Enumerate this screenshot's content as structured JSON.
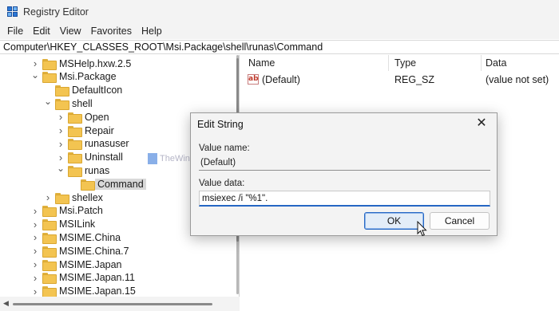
{
  "window": {
    "title": "Registry Editor"
  },
  "menu": [
    "File",
    "Edit",
    "View",
    "Favorites",
    "Help"
  ],
  "address": "Computer\\HKEY_CLASSES_ROOT\\Msi.Package\\shell\\runas\\Command",
  "tree": [
    {
      "label": "MSHelp.hxw.2.5",
      "level": 0,
      "chevron": "right"
    },
    {
      "label": "Msi.Package",
      "level": 0,
      "chevron": "down"
    },
    {
      "label": "DefaultIcon",
      "level": 1,
      "chevron": "none"
    },
    {
      "label": "shell",
      "level": 1,
      "chevron": "down"
    },
    {
      "label": "Open",
      "level": 2,
      "chevron": "right"
    },
    {
      "label": "Repair",
      "level": 2,
      "chevron": "right"
    },
    {
      "label": "runasuser",
      "level": 2,
      "chevron": "right"
    },
    {
      "label": "Uninstall",
      "level": 2,
      "chevron": "right"
    },
    {
      "label": "runas",
      "level": 2,
      "chevron": "down"
    },
    {
      "label": "Command",
      "level": 3,
      "chevron": "none",
      "selected": true
    },
    {
      "label": "shellex",
      "level": 1,
      "chevron": "right"
    },
    {
      "label": "Msi.Patch",
      "level": 0,
      "chevron": "right"
    },
    {
      "label": "MSILink",
      "level": 0,
      "chevron": "right"
    },
    {
      "label": "MSIME.China",
      "level": 0,
      "chevron": "right"
    },
    {
      "label": "MSIME.China.7",
      "level": 0,
      "chevron": "right"
    },
    {
      "label": "MSIME.Japan",
      "level": 0,
      "chevron": "right"
    },
    {
      "label": "MSIME.Japan.11",
      "level": 0,
      "chevron": "right"
    },
    {
      "label": "MSIME.Japan.15",
      "level": 0,
      "chevron": "right"
    }
  ],
  "values_pane": {
    "headers": {
      "name": "Name",
      "type": "Type",
      "data": "Data"
    },
    "rows": [
      {
        "icon": "string-value-icon",
        "name": "(Default)",
        "type": "REG_SZ",
        "data": "(value not set)"
      }
    ]
  },
  "dialog": {
    "title": "Edit String",
    "value_name_label": "Value name:",
    "value_name": "(Default)",
    "value_data_label": "Value data:",
    "value_data": "msiexec /i \"%1\".",
    "ok_label": "OK",
    "cancel_label": "Cancel"
  },
  "watermark": {
    "text": "TheWindowsClub"
  },
  "colors": {
    "accent": "#2567c4",
    "folder": "#f3c451",
    "selection": "#d9d9d9"
  }
}
